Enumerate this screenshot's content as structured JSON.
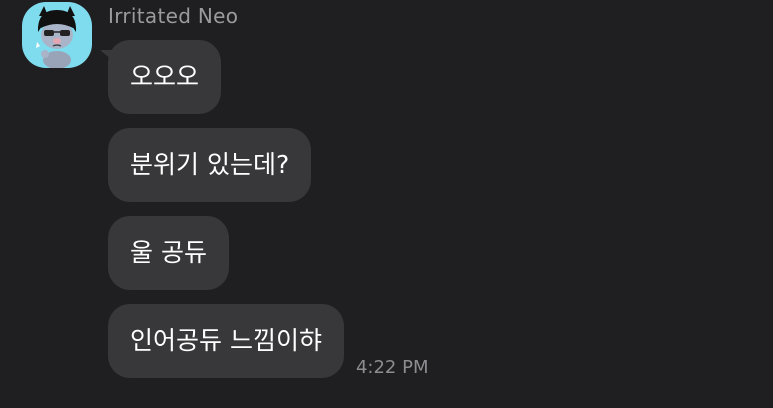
{
  "chat": {
    "sender_name": "Irritated Neo",
    "avatar_icon": "neo-character-icon",
    "avatar_bg": "#7fdcee",
    "bubble_color": "#38383a",
    "background": "#1f1f21",
    "messages": [
      {
        "text": "오오오"
      },
      {
        "text": "분위기 있는데?"
      },
      {
        "text": "울 공듀"
      },
      {
        "text": "인어공듀 느낌이햐",
        "time": "4:22 PM"
      }
    ]
  }
}
